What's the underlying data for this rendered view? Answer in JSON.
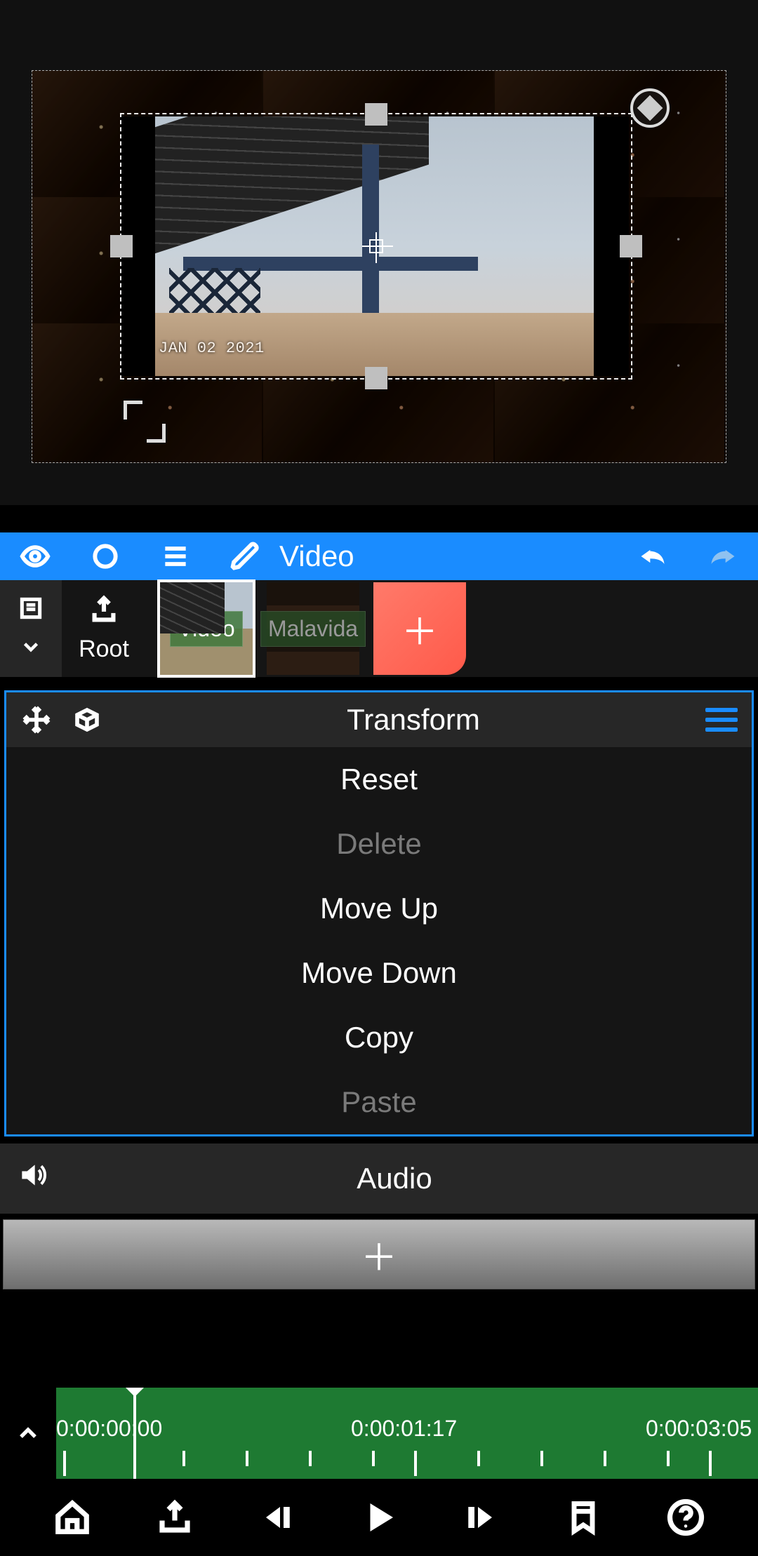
{
  "preview": {
    "date_stamp": "JAN 02 2021"
  },
  "toolbar": {
    "title": "Video"
  },
  "layers": {
    "root_label": "Root",
    "thumbs": [
      {
        "label": "Video"
      },
      {
        "label": "Malavida"
      }
    ]
  },
  "panel": {
    "title": "Transform",
    "items": [
      {
        "label": "Reset",
        "disabled": false
      },
      {
        "label": "Delete",
        "disabled": true
      },
      {
        "label": "Move Up",
        "disabled": false
      },
      {
        "label": "Move Down",
        "disabled": false
      },
      {
        "label": "Copy",
        "disabled": false
      },
      {
        "label": "Paste",
        "disabled": true
      }
    ]
  },
  "audio": {
    "title": "Audio"
  },
  "timeline": {
    "t0": "0:00:00:00",
    "t1": "0:00:01:17",
    "t2": "0:00:03:05"
  }
}
